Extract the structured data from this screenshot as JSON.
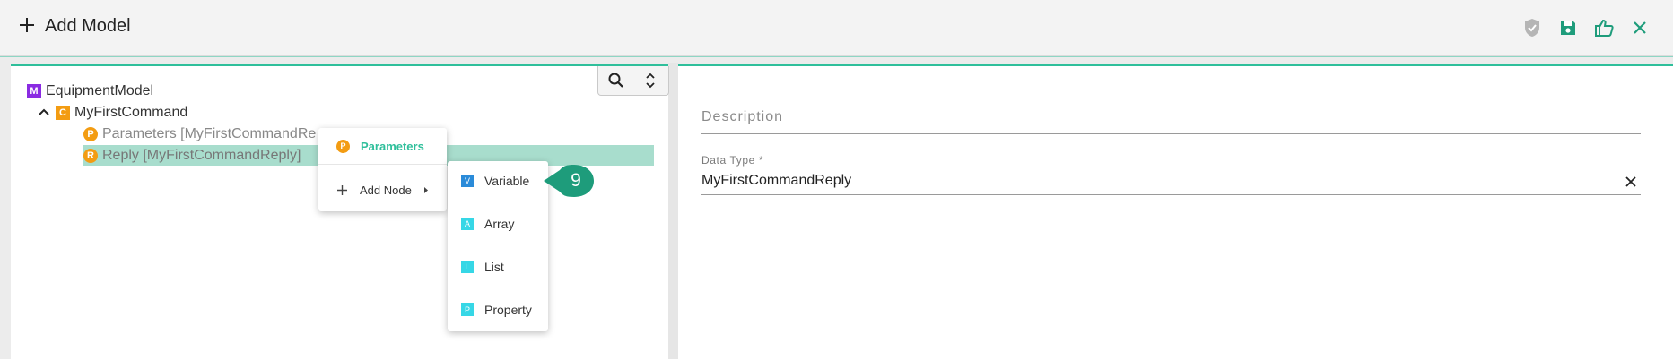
{
  "header": {
    "title": "Add Model",
    "actions": [
      "shield-check-icon",
      "save-icon",
      "thumbs-up-icon",
      "close-icon"
    ]
  },
  "colors": {
    "accent": "#2fbf9b",
    "highlight": "#a8ddcd",
    "model_badge": "#8a2be2",
    "command_badge": "#f39c12"
  },
  "tree": {
    "root": {
      "badge": "M",
      "label": "EquipmentModel"
    },
    "command": {
      "badge": "C",
      "label": "MyFirstCommand"
    },
    "parameters": {
      "badge": "P",
      "label": "Parameters [MyFirstCommandRe"
    },
    "reply": {
      "badge": "R",
      "label": "Reply [MyFirstCommandReply]"
    }
  },
  "context_menu": {
    "parameters": {
      "badge": "P",
      "label": "Parameters"
    },
    "add_node": {
      "label": "Add Node"
    }
  },
  "submenu": [
    {
      "badge": "V",
      "label": "Variable",
      "color": "#2a8bd9"
    },
    {
      "badge": "A",
      "label": "Array",
      "color": "#36d7e6"
    },
    {
      "badge": "L",
      "label": "List",
      "color": "#36d7e6"
    },
    {
      "badge": "P",
      "label": "Property",
      "color": "#36d7e6"
    }
  ],
  "callout": {
    "number": "9"
  },
  "form": {
    "description": {
      "label": "Description",
      "value": ""
    },
    "data_type": {
      "label": "Data Type *",
      "value": "MyFirstCommandReply"
    }
  }
}
